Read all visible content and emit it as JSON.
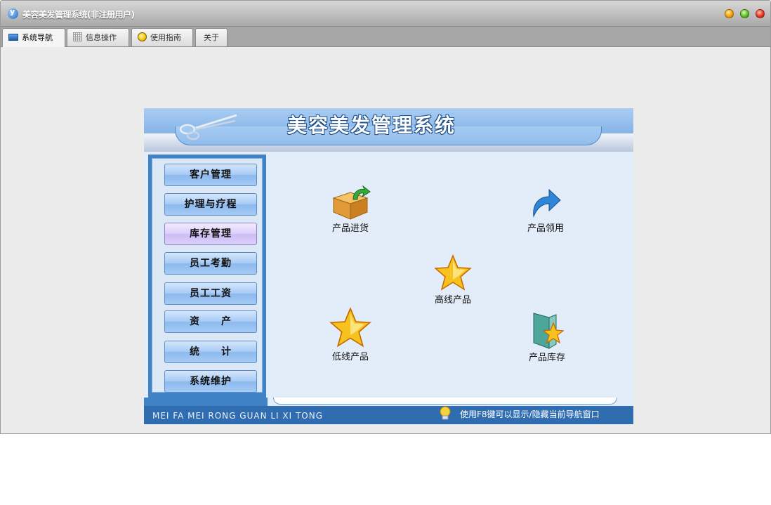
{
  "window": {
    "title": "美容美发管理系统(非注册用户)"
  },
  "tabs": [
    {
      "label": "系统导航",
      "icon": "monitor-icon",
      "active": true
    },
    {
      "label": "信息操作",
      "icon": "grid-icon",
      "active": false
    },
    {
      "label": "使用指南",
      "icon": "bulb-icon",
      "active": false
    },
    {
      "label": "关于",
      "icon": "",
      "active": false
    }
  ],
  "panel": {
    "title": "美容美发管理系统",
    "footer_text": "MEI FA MEI RONG GUAN LI XI TONG",
    "hint": "使用F8键可以显示/隐藏当前导航窗口"
  },
  "nav": [
    {
      "label": "客户管理",
      "active": false
    },
    {
      "label": "护理与疗程",
      "active": false
    },
    {
      "label": "库存管理",
      "active": true
    },
    {
      "label": "员工考勤",
      "active": false
    },
    {
      "label": "员工工资",
      "active": false
    },
    {
      "label": "资　　产",
      "active": false
    },
    {
      "label": "统　　计",
      "active": false
    },
    {
      "label": "系统维护",
      "active": false
    }
  ],
  "features": [
    {
      "label": "产品进货",
      "icon": "box-in-icon"
    },
    {
      "label": "产品领用",
      "icon": "curved-arrow-icon"
    },
    {
      "label": "高线产品",
      "icon": "star-icon"
    },
    {
      "label": "低线产品",
      "icon": "star-icon"
    },
    {
      "label": "产品库存",
      "icon": "book-star-icon"
    }
  ],
  "colors": {
    "accent": "#3f83c6",
    "footer": "#2f6db0",
    "active_nav": "#dcd0fa"
  }
}
